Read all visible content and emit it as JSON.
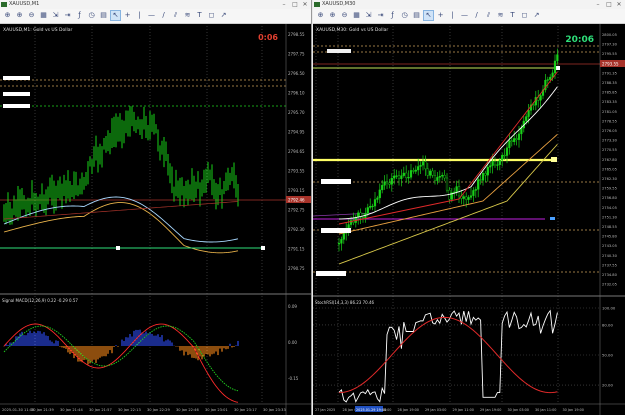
{
  "left": {
    "title": "XAUUSD,M1",
    "chart_label": "XAUUSD,M1:  Gold vs US Dollar",
    "timer": "0:06",
    "price_labels": [
      "2798.55",
      "2797.75",
      "2796.50",
      "2796.10",
      "2795.70",
      "2794.95",
      "2794.65",
      "2793.55",
      "2793.15",
      "2792.75",
      "2792.30",
      "2791.15",
      "2790.75"
    ],
    "price_tag": "2792.46",
    "indicator_label": "Signal MACD(12,26,9)  0.22  -0.29  0.57",
    "indicator_levels": [
      "0.09",
      "0.00",
      "-0.15"
    ],
    "time_labels": [
      "2025-01-30 11:05",
      "30 Jan 21:39",
      "30 Jan 21:44",
      "30 Jan 21:57",
      "30 Jan 22:13",
      "30 Jan 22:29",
      "30 Jan 22:46",
      "30 Jan 23:01",
      "30 Jan 23:17",
      "30 Jan 23:33"
    ]
  },
  "right": {
    "title": "XAUUSD,M30",
    "chart_label": "XAUUSD,M30:  Gold vs US Dollar",
    "timer": "20:06",
    "price_labels": [
      "2800.05",
      "2797.30",
      "2795.55",
      "2793.55",
      "2791.35",
      "2788.35",
      "2785.85",
      "2783.35",
      "2781.05",
      "2778.55",
      "2776.05",
      "2773.30",
      "2770.55",
      "2767.80",
      "2765.05",
      "2762.30",
      "2759.55",
      "2756.80",
      "2754.05",
      "2751.30",
      "2748.55",
      "2745.80",
      "2743.05",
      "2740.30",
      "2737.55",
      "2734.80",
      "2732.05"
    ],
    "price_tag": "2793.55",
    "indicator_label": "StochRSI(14,3,3)  86.23  70.46",
    "indicator_levels": [
      "100.00",
      "80.00",
      "50.00",
      "20.00"
    ],
    "time_labels": [
      "27 Jan 2025",
      "28 Jan 03:00",
      "28 Jan 11:00",
      "28 Jan 19:00",
      "29 Jan 03:00",
      "29 Jan 11:00",
      "29 Jan 19:00",
      "30 Jan 03:00",
      "30 Jan 11:00",
      "30 Jan 19:00"
    ],
    "highlight_time": "2025.01.29 19:00"
  },
  "toolbar_icons": [
    "crosshair-icon",
    "zoom-in-icon",
    "zoom-out-icon",
    "grid-icon",
    "autoscroll-icon",
    "chart-shift-icon",
    "indicators-icon",
    "periods-icon",
    "templates-icon",
    "cursor-icon",
    "crosshair2-icon",
    "vertical-line-icon",
    "horizontal-line-icon",
    "trendline-icon",
    "channel-icon",
    "fibo-icon",
    "text-icon",
    "label-icon",
    "arrow-icon"
  ],
  "toolbar_glyphs": [
    "⊕",
    "⊕",
    "⊖",
    "▦",
    "⇲",
    "⇥",
    "ƒ",
    "◷",
    "▤",
    "↖",
    "+",
    "|",
    "—",
    "/",
    "⫽",
    "≋",
    "T",
    "◻",
    "↗"
  ],
  "colors": {
    "candle": "#19d219",
    "accent": "#ffff66",
    "bg": "#000000"
  }
}
